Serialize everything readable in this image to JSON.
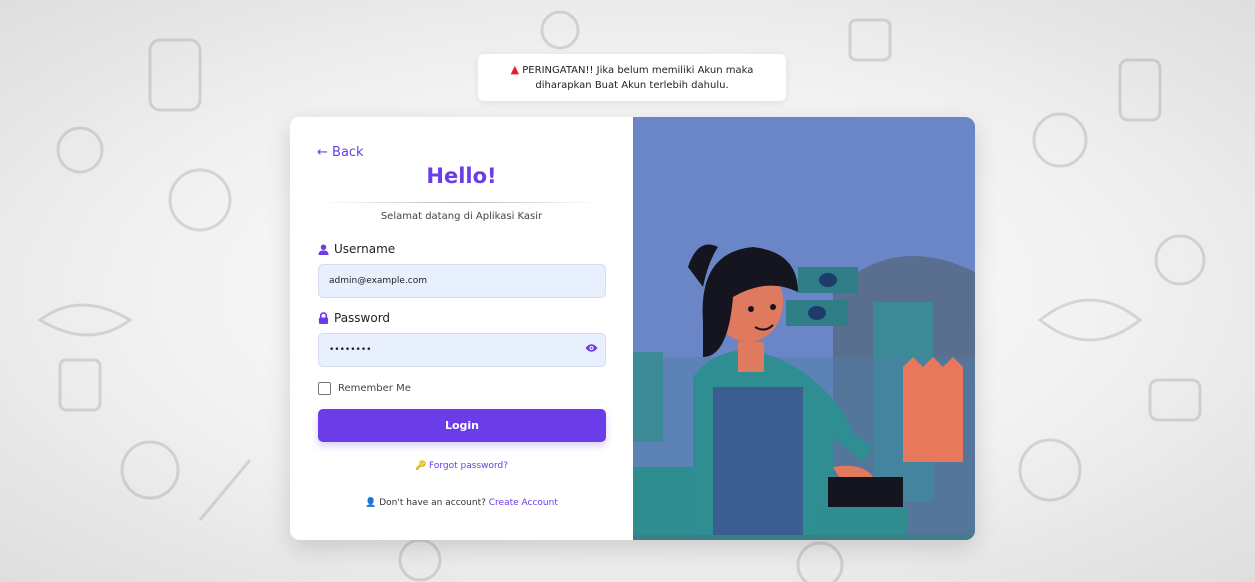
{
  "alert": {
    "line1": "PERINGATAN!! Jika belum memiliki Akun maka",
    "line2": "diharapkan Buat Akun terlebih dahulu.",
    "icon": "warning-icon",
    "color": "#e3202a"
  },
  "login": {
    "back_label": "← Back",
    "title": "Hello!",
    "subtitle": "Selamat datang di Aplikasi Kasir",
    "username_label": "Username",
    "username_value": "admin@example.com",
    "password_label": "Password",
    "password_value": "admin123",
    "remember_label": "Remember Me",
    "login_button": "Login",
    "forgot_label": "Forgot password?",
    "signup_text": "Don't have an account?",
    "signup_link": "Create Account"
  },
  "colors": {
    "accent": "#6a3de8",
    "illustration_bg": "#6b86c7",
    "field_bg": "#e8f0fe"
  }
}
